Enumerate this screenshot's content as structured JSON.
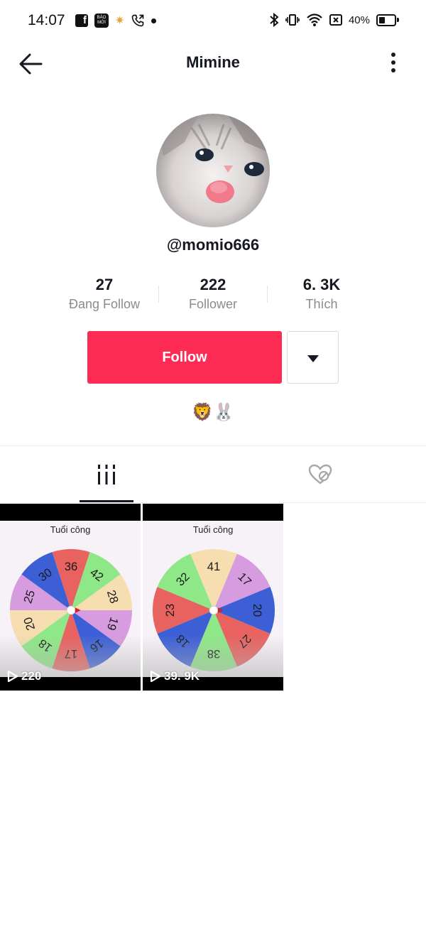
{
  "status_bar": {
    "time": "14:07",
    "left_icons": [
      "facebook-icon",
      "baomoi-icon",
      "photos-icon",
      "phone-call-icon",
      "dot-icon"
    ],
    "baomoi_text": "BÁO MỚI",
    "fb_text": "f",
    "battery": "40%",
    "right_icons": [
      "bluetooth-icon",
      "vibrate-icon",
      "wifi-icon",
      "sim-icon",
      "battery-icon"
    ]
  },
  "nav": {
    "title": "Mimine",
    "back_icon": "arrow-left-icon",
    "more_icon": "more-vertical-icon"
  },
  "profile": {
    "username": "@momio666",
    "stats": [
      {
        "value": "27",
        "label": "Đang Follow"
      },
      {
        "value": "222",
        "label": "Follower"
      },
      {
        "value": "6. 3K",
        "label": "Thích"
      }
    ],
    "follow_label": "Follow",
    "dropdown_icon": "caret-down-icon",
    "bio": "🦁🐰"
  },
  "tabs": [
    {
      "name": "videos",
      "icon": "grid-bars-icon",
      "active": true
    },
    {
      "name": "liked",
      "icon": "heart-hidden-icon",
      "active": false
    }
  ],
  "videos": [
    {
      "title": "Tuổi công",
      "views": "220",
      "wheel_numbers": [
        "36",
        "42",
        "28",
        "19",
        "16",
        "17",
        "18",
        "20",
        "25",
        "30"
      ]
    },
    {
      "title": "Tuổi công",
      "views": "39. 9K",
      "wheel_numbers": [
        "41",
        "17",
        "20",
        "27",
        "38",
        "18",
        "23",
        "32"
      ]
    }
  ],
  "colors": {
    "accent": "#fe2c55",
    "text_primary": "#161823",
    "text_secondary": "#8a8b91",
    "wheel_segments": [
      "#e8625f",
      "#8ee887",
      "#f6deb0",
      "#d79be0",
      "#3c5fd6"
    ]
  }
}
